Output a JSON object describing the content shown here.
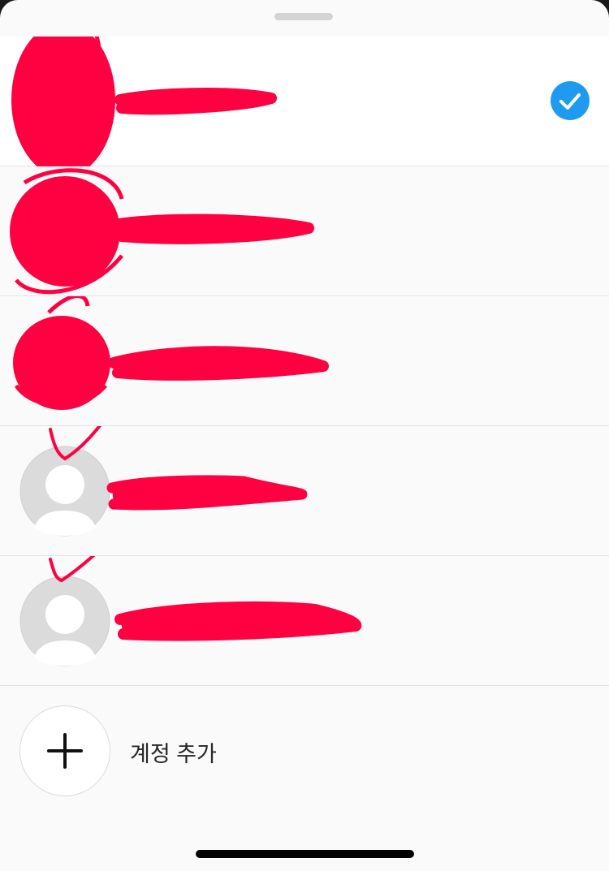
{
  "sheet": {
    "accounts": [
      {
        "username": "",
        "selected": true,
        "avatar": "profile-photo-redacted"
      },
      {
        "username": "",
        "selected": false,
        "avatar": "profile-photo-redacted"
      },
      {
        "username": "",
        "selected": false,
        "avatar": "profile-photo-redacted"
      },
      {
        "username": "",
        "selected": false,
        "avatar": "default-avatar-icon"
      },
      {
        "username": "",
        "selected": false,
        "avatar": "default-avatar-icon"
      }
    ],
    "add_account_label": "계정 추가"
  },
  "colors": {
    "accent": "#1e9bf0",
    "redaction": "#ff0040",
    "sheet_background": "#fafafa",
    "selected_row_background": "#ffffff",
    "placeholder_avatar": "#dbdbdb"
  },
  "icons": {
    "selected": "check-icon",
    "add": "plus-icon",
    "grabber": "sheet-grabber"
  }
}
